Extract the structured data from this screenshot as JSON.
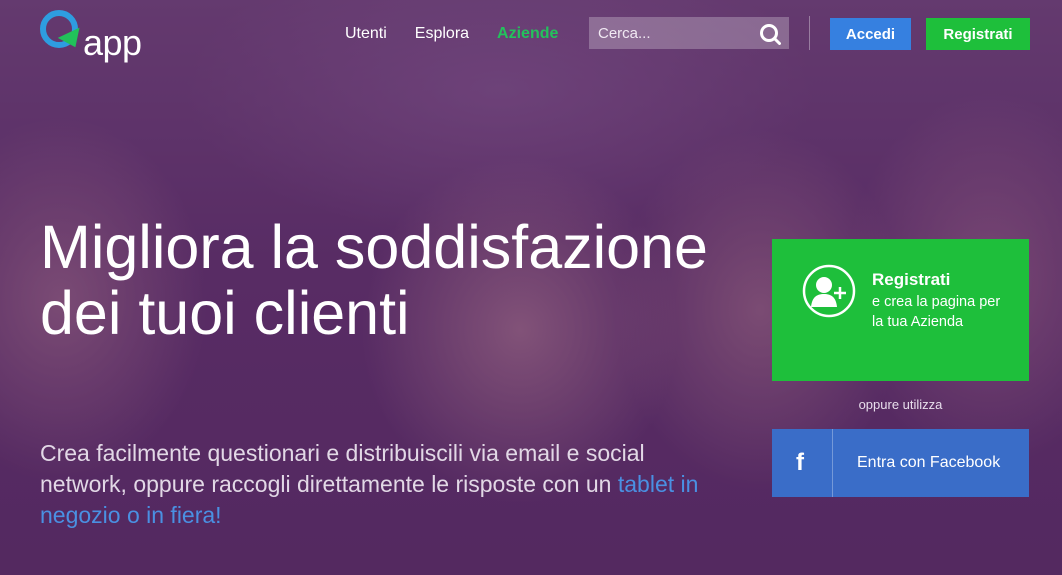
{
  "header": {
    "logo_text": "app",
    "nav": [
      {
        "label": "Utenti",
        "active": false
      },
      {
        "label": "Esplora",
        "active": false
      },
      {
        "label": "Aziende",
        "active": true
      }
    ],
    "search": {
      "placeholder": "Cerca..."
    },
    "login_label": "Accedi",
    "register_label": "Registrati"
  },
  "hero": {
    "headline": "Migliora la soddisfazione dei tuoi clienti",
    "subheadline_main": "Crea facilmente questionari e distribuiscili via email e social network, oppure raccogli direttamente le risposte con un ",
    "subheadline_highlight": "tablet in negozio o in fiera!"
  },
  "cta": {
    "register_title": "Registrati",
    "register_desc": "e crea la pagina per la tua Azienda",
    "alternative_text": "oppure utilizza",
    "facebook_icon": "f",
    "facebook_label": "Entra con Facebook"
  },
  "colors": {
    "green": "#1ebf3b",
    "blue": "#3680e0",
    "facebook_blue": "#3a6dc8",
    "highlight_blue": "#4a90e2",
    "overlay_purple": "#5a2f63"
  },
  "icons": {
    "logo": "q-logo-icon",
    "search": "search-icon",
    "register": "user-add-icon",
    "facebook": "facebook-icon"
  }
}
